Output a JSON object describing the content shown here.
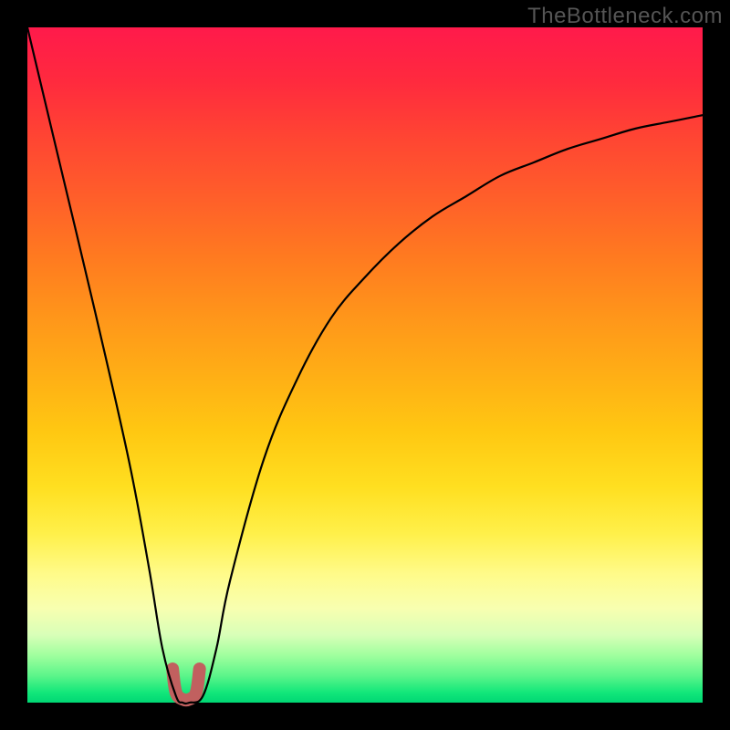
{
  "watermark": "TheBottleneck.com",
  "chart_data": {
    "type": "line",
    "title": "",
    "xlabel": "",
    "ylabel": "",
    "xlim": [
      0,
      100
    ],
    "ylim": [
      0,
      100
    ],
    "series": [
      {
        "name": "bottleneck-curve",
        "x": [
          0,
          5,
          10,
          15,
          18,
          20,
          22,
          23,
          24,
          26,
          28,
          30,
          35,
          40,
          45,
          50,
          55,
          60,
          65,
          70,
          75,
          80,
          85,
          90,
          95,
          100
        ],
        "y": [
          100,
          79,
          58,
          36,
          20,
          8,
          1,
          0,
          0,
          1,
          8,
          18,
          36,
          48,
          57,
          63,
          68,
          72,
          75,
          78,
          80,
          82,
          83.5,
          85,
          86,
          87
        ]
      },
      {
        "name": "optimal-zone-marker",
        "x": [
          21.5,
          22,
          23,
          24,
          25,
          25.5
        ],
        "y": [
          5,
          1.5,
          0.5,
          0.5,
          1.5,
          5
        ]
      }
    ],
    "colors": {
      "curve": "#000000",
      "marker": "#c1605f",
      "gradient_top": "#ff1a4b",
      "gradient_mid": "#ffdf20",
      "gradient_bottom": "#00d774"
    }
  }
}
